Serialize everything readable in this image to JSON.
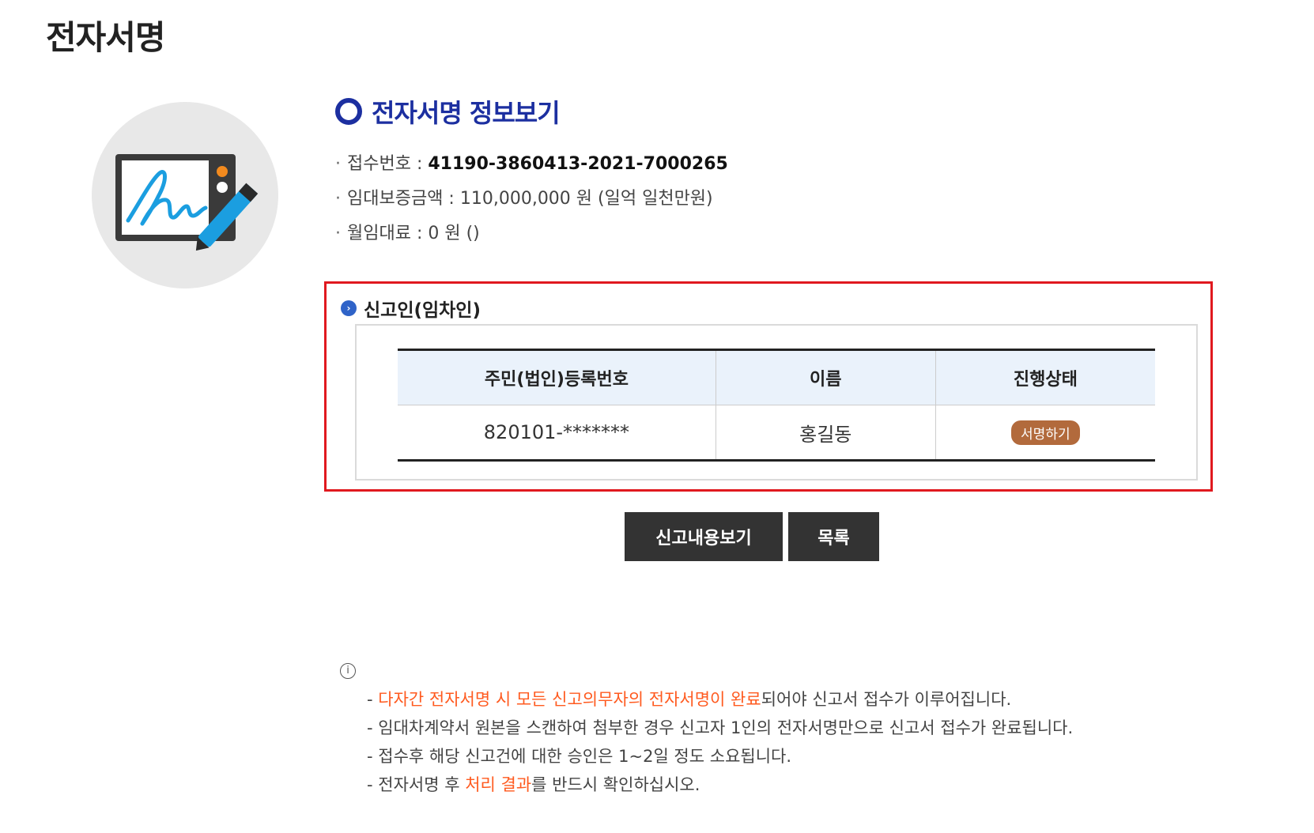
{
  "page": {
    "title": "전자서명"
  },
  "info": {
    "title": "전자서명 정보보기",
    "lines": [
      {
        "label": "접수번호 : ",
        "value": "41190-3860413-2021-7000265"
      },
      {
        "label": "임대보증금액 : ",
        "value": "110,000,000 원 (일억 일천만원)"
      },
      {
        "label": "월임대료 : ",
        "value": "0 원 ()"
      }
    ]
  },
  "applicant": {
    "title": "신고인(임차인)",
    "columns": [
      "주민(법인)등록번호",
      "이름",
      "진행상태"
    ],
    "row": {
      "id_number": "820101-*******",
      "name": "홍길동",
      "status_button": "서명하기"
    }
  },
  "buttons": {
    "view_report": "신고내용보기",
    "list": "목록"
  },
  "notice": {
    "icon_glyph": "i",
    "lines": [
      {
        "prefix": "- ",
        "highlight": "다자간 전자서명 시 모든 신고의무자의 전자서명이 완료",
        "suffix": "되어야 신고서 접수가 이루어집니다."
      },
      {
        "prefix": "- ",
        "highlight": "",
        "suffix": "임대차계약서 원본을 스캔하여 첨부한 경우 신고자 1인의 전자서명만으로 신고서 접수가 완료됩니다."
      },
      {
        "prefix": "- ",
        "highlight": "",
        "suffix": "접수후 해당 신고건에 대한 승인은 1~2일 정도 소요됩니다."
      },
      {
        "prefix": "- 전자서명 후 ",
        "highlight": "처리 결과",
        "suffix": "를 반드시 확인하십시오."
      }
    ]
  },
  "colors": {
    "accent_blue": "#1c2fa0",
    "highlight_box": "#e0191f",
    "sign_button": "#b26a3c",
    "dark_button": "#333333",
    "notice_highlight": "#ff5a1f"
  },
  "icons": {
    "illustration": "signature-tablet-icon",
    "info_title": "ring-icon",
    "section": "circle-arrow-icon",
    "notice": "info-icon"
  }
}
